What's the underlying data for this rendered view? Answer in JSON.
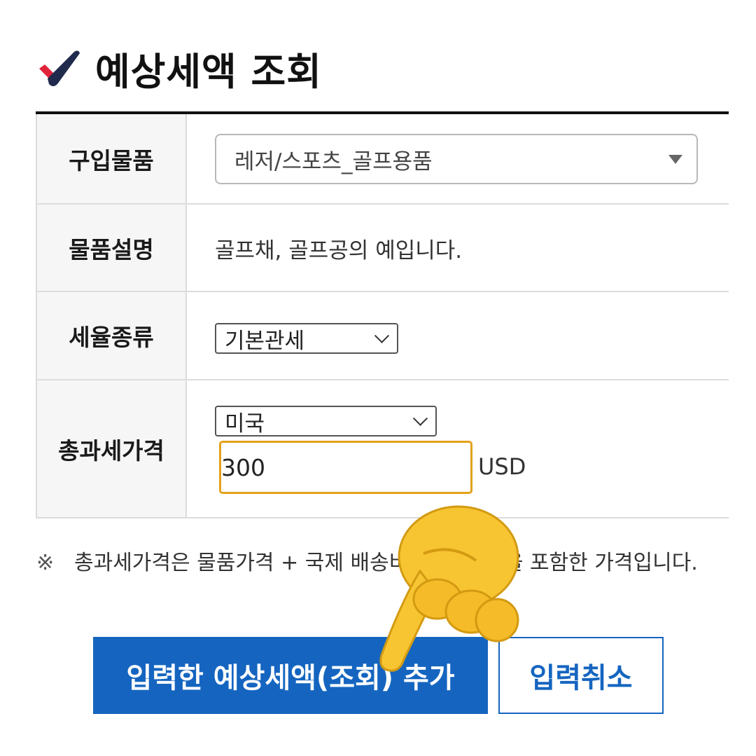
{
  "page": {
    "title": "예상세액 조회"
  },
  "form": {
    "item": {
      "label": "구입물품",
      "value": "레저/스포츠_골프용품"
    },
    "description": {
      "label": "물품설명",
      "value": "골프채, 골프공의 예입니다."
    },
    "tax_type": {
      "label": "세율종류",
      "value": "기본관세"
    },
    "price": {
      "label": "총과세가격",
      "country": "미국",
      "amount": "300",
      "currency": "USD"
    }
  },
  "note": {
    "mark": "※",
    "text": "총과세가격은 물품가격 + 국제 배송비 + 보험 등을 포함한 가격입니다."
  },
  "buttons": {
    "add": "입력한 예상세액(조회) 추가",
    "cancel": "입력취소"
  },
  "colors": {
    "accent": "#1565c0",
    "focus": "#e3a21a",
    "check_red": "#e0233a",
    "check_navy": "#1f2a4d"
  },
  "icons": {
    "title": "check-icon",
    "overlay": "pointing-hand-icon"
  }
}
